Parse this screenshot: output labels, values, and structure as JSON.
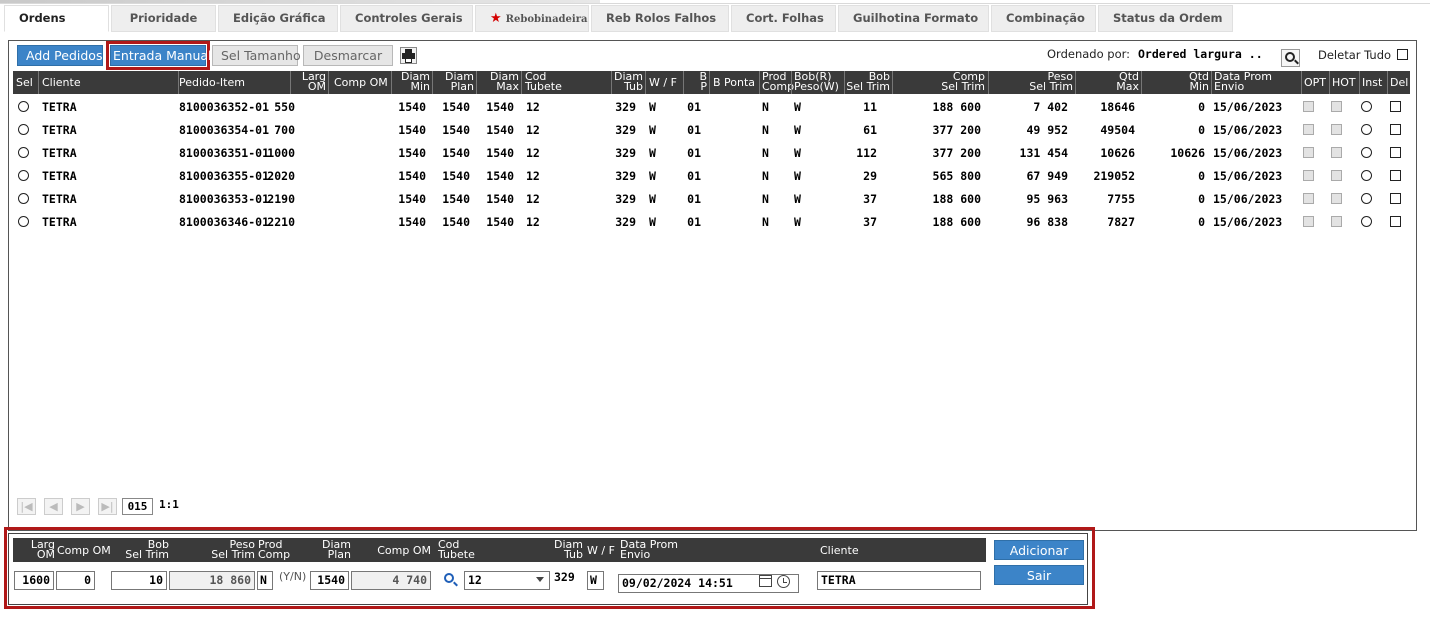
{
  "tabs": [
    {
      "label": "Ordens"
    },
    {
      "label": "Prioridade"
    },
    {
      "label": "Edição Gráfica"
    },
    {
      "label": "Controles Gerais"
    },
    {
      "label": "Rebobinadeira"
    },
    {
      "label": "Reb Rolos Falhos"
    },
    {
      "label": "Cort. Folhas"
    },
    {
      "label": "Guilhotina Formato"
    },
    {
      "label": "Combinação"
    },
    {
      "label": "Status da Ordem"
    }
  ],
  "toolbar": {
    "add_pedidos": "Add Pedidos",
    "entrada_manual": "Entrada Manual",
    "sel_tamanho": "Sel Tamanho",
    "desmarcar": "Desmarcar",
    "ordered_label": "Ordenado por:",
    "ordered_value": "Ordered largura ..",
    "deletar_tudo": "Deletar Tudo"
  },
  "icons": {
    "print": "printer-icon",
    "search": "magnifier-icon",
    "calendar": "calendar-icon",
    "clock": "clock-icon",
    "star": "star-icon"
  },
  "colors": {
    "accent_blue": "#3c84c8",
    "header_dark": "#3a3a3a",
    "highlight_red": "#b01818",
    "star_red": "#d40000"
  },
  "grid": {
    "headers": {
      "sel": "Sel",
      "cliente": "Cliente",
      "pedido_item": "Pedido-Item",
      "larg_om_1": "Larg",
      "larg_om_2": "OM",
      "comp_om": "Comp OM",
      "diam_min_1": "Diam",
      "diam_min_2": "Min",
      "diam_plan_1": "Diam",
      "diam_plan_2": "Plan",
      "diam_max_1": "Diam",
      "diam_max_2": "Max",
      "cod_tubete_1": "Cod",
      "cod_tubete_2": "Tubete",
      "diam_tub_1": "Diam",
      "diam_tub_2": "Tub",
      "wf": "W / F",
      "bp_1": "B",
      "bp_2": "P",
      "b_ponta": "B Ponta",
      "prod_comp_1": "Prod",
      "prod_comp_2": "Comp",
      "bob_peso_1": "Bob(R)",
      "bob_peso_2": "Peso(W)",
      "bob_sel_trim_1": "Bob",
      "bob_sel_trim_2": "Sel Trim",
      "comp_sel_trim_1": "Comp",
      "comp_sel_trim_2": "Sel Trim",
      "peso_sel_trim_1": "Peso",
      "peso_sel_trim_2": "Sel Trim",
      "qtd_max_1": "Qtd",
      "qtd_max_2": "Max",
      "qtd_min_1": "Qtd",
      "qtd_min_2": "Min",
      "data_prom_1": "Data Prom",
      "data_prom_2": "Envio",
      "opt": "OPT",
      "hot": "HOT",
      "inst": "Inst",
      "del": "Del"
    },
    "rows": [
      {
        "cliente": "TETRA",
        "pedido": "8100036352-01",
        "larg": "550",
        "dmin": "1540",
        "dplan": "1540",
        "dmax": "1540",
        "cod": "12",
        "dtub": "329",
        "wf": "W",
        "bp": "01",
        "prod": "N",
        "bob": "W",
        "bobsel": "11",
        "comp": "188 600",
        "peso": "7 402",
        "qmax": "18646",
        "qmin": "0",
        "data": "15/06/2023"
      },
      {
        "cliente": "TETRA",
        "pedido": "8100036354-01",
        "larg": "700",
        "dmin": "1540",
        "dplan": "1540",
        "dmax": "1540",
        "cod": "12",
        "dtub": "329",
        "wf": "W",
        "bp": "01",
        "prod": "N",
        "bob": "W",
        "bobsel": "61",
        "comp": "377 200",
        "peso": "49 952",
        "qmax": "49504",
        "qmin": "0",
        "data": "15/06/2023"
      },
      {
        "cliente": "TETRA",
        "pedido": "8100036351-01",
        "larg": "1000",
        "dmin": "1540",
        "dplan": "1540",
        "dmax": "1540",
        "cod": "12",
        "dtub": "329",
        "wf": "W",
        "bp": "01",
        "prod": "N",
        "bob": "W",
        "bobsel": "112",
        "comp": "377 200",
        "peso": "131 454",
        "qmax": "10626",
        "qmin": "10626",
        "data": "15/06/2023"
      },
      {
        "cliente": "TETRA",
        "pedido": "8100036355-01",
        "larg": "2020",
        "dmin": "1540",
        "dplan": "1540",
        "dmax": "1540",
        "cod": "12",
        "dtub": "329",
        "wf": "W",
        "bp": "01",
        "prod": "N",
        "bob": "W",
        "bobsel": "29",
        "comp": "565 800",
        "peso": "67 949",
        "qmax": "219052",
        "qmin": "0",
        "data": "15/06/2023"
      },
      {
        "cliente": "TETRA",
        "pedido": "8100036353-01",
        "larg": "2190",
        "dmin": "1540",
        "dplan": "1540",
        "dmax": "1540",
        "cod": "12",
        "dtub": "329",
        "wf": "W",
        "bp": "01",
        "prod": "N",
        "bob": "W",
        "bobsel": "37",
        "comp": "188 600",
        "peso": "95 963",
        "qmax": "7755",
        "qmin": "0",
        "data": "15/06/2023"
      },
      {
        "cliente": "TETRA",
        "pedido": "8100036346-01",
        "larg": "2210",
        "dmin": "1540",
        "dplan": "1540",
        "dmax": "1540",
        "cod": "12",
        "dtub": "329",
        "wf": "W",
        "bp": "01",
        "prod": "N",
        "bob": "W",
        "bobsel": "37",
        "comp": "188 600",
        "peso": "96 838",
        "qmax": "7827",
        "qmin": "0",
        "data": "15/06/2023"
      }
    ]
  },
  "pager": {
    "page": "015",
    "count": "1:1"
  },
  "entry": {
    "headers": {
      "larg_1": "Larg",
      "larg_2": "OM",
      "comp_om": "Comp OM",
      "bob_1": "Bob",
      "bob_2": "Sel Trim",
      "peso_1": "Peso",
      "peso_2": "Sel Trim",
      "prod_1": "Prod",
      "prod_2": "Comp",
      "diam_plan_1": "Diam",
      "diam_plan_2": "Plan",
      "comp_om2": "Comp OM",
      "cod_1": "Cod",
      "cod_2": "Tubete",
      "diam_tub_1": "Diam",
      "diam_tub_2": "Tub",
      "wf": "W / F",
      "data_1": "Data Prom",
      "data_2": "Envio",
      "cliente": "Cliente"
    },
    "values": {
      "larg": "1600",
      "comp_om": "0",
      "bob": "10",
      "peso": "18 860",
      "prod": "N",
      "yn": "(Y/N)",
      "diam_plan": "1540",
      "comp_om2": "4 740",
      "cod": "12",
      "diam_tub": "329",
      "wf": "W",
      "data": "09/02/2024 14:51",
      "cliente": "TETRA"
    },
    "adicionar": "Adicionar",
    "sair": "Sair"
  }
}
